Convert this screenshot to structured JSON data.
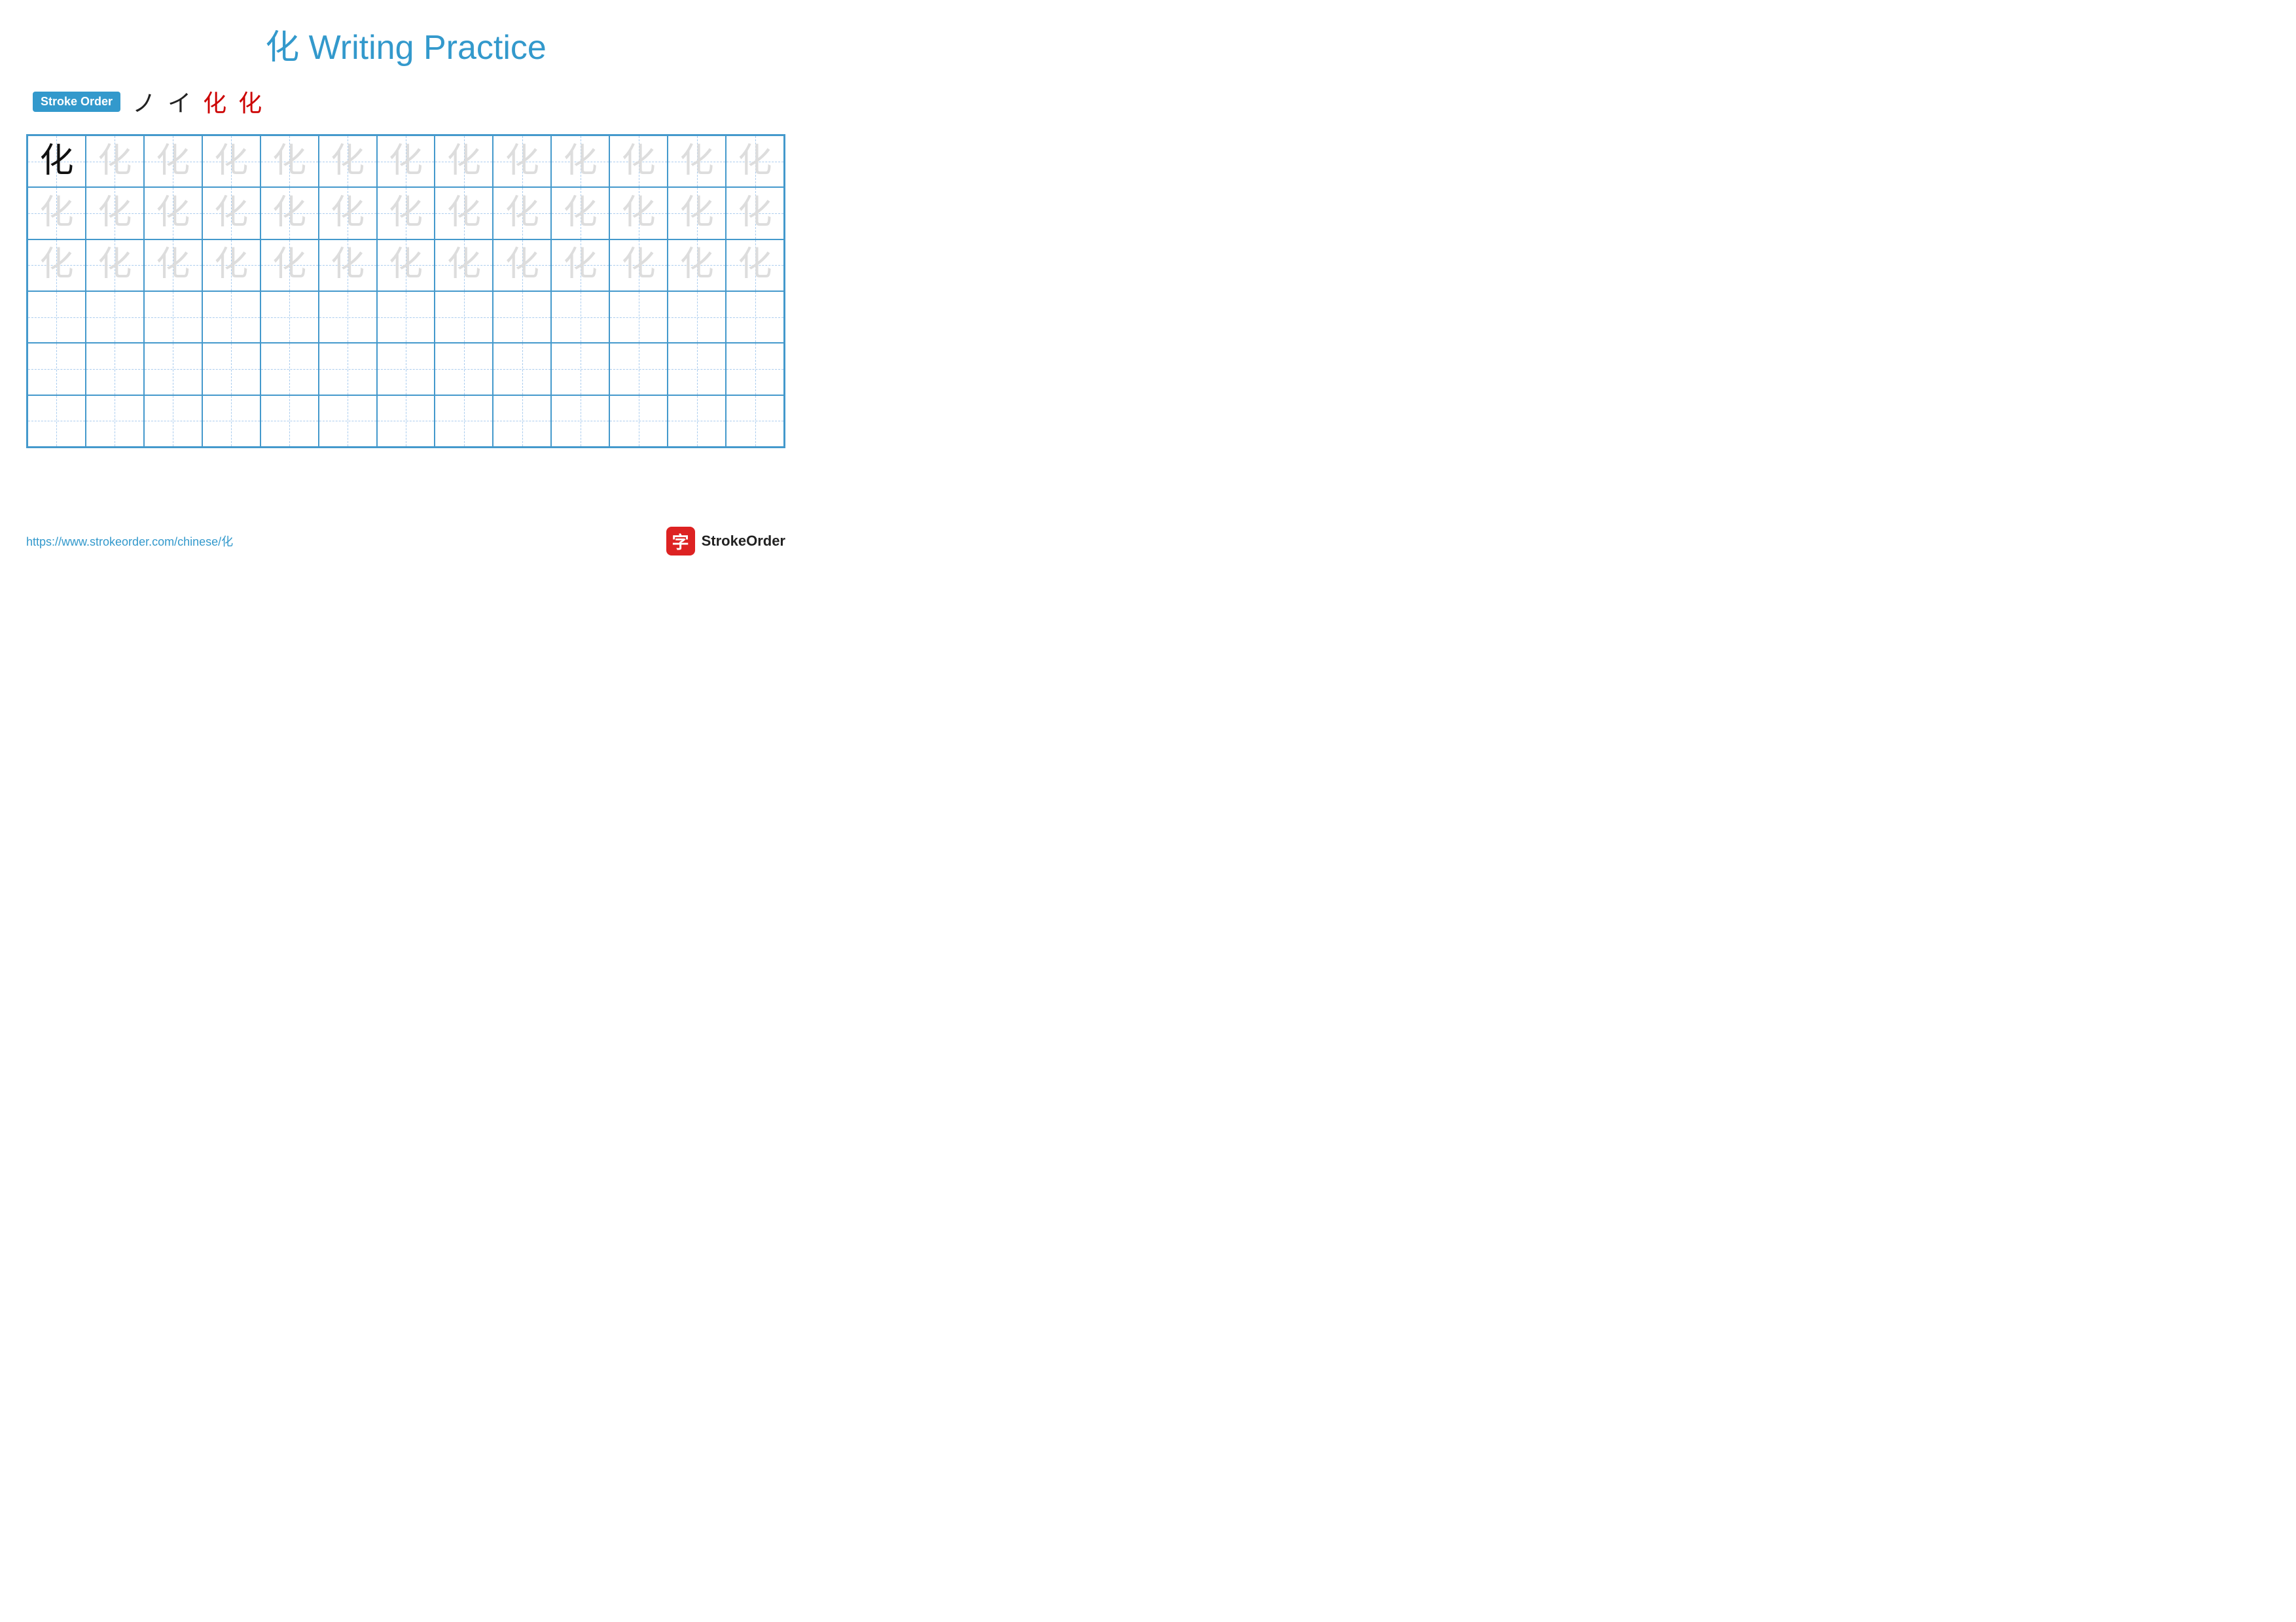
{
  "title": {
    "character": "化",
    "rest": " Writing Practice"
  },
  "stroke_order": {
    "badge_label": "Stroke Order",
    "steps": [
      "ノ",
      "イ",
      "化",
      "化"
    ]
  },
  "grid": {
    "cols": 13,
    "rows": 6,
    "character": "化",
    "row_types": [
      "dark_then_light",
      "light_all",
      "light_all",
      "empty",
      "empty",
      "empty"
    ]
  },
  "footer": {
    "url": "https://www.strokeorder.com/chinese/化",
    "brand_char": "字",
    "brand_name": "StrokeOrder"
  }
}
